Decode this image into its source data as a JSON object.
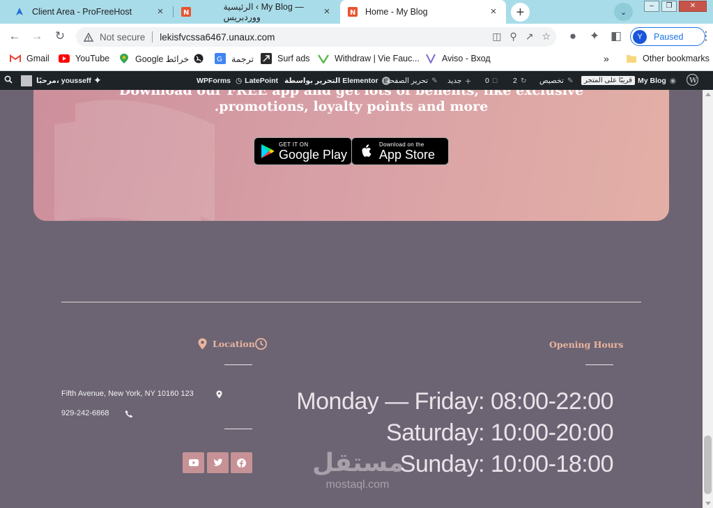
{
  "browser": {
    "tabs": [
      {
        "title": "Client Area - ProFreeHost",
        "icon": "profreehost-favicon",
        "active": false
      },
      {
        "title": "الرئيسية ‹ My Blog — ووردبريس",
        "icon": "blog-favicon",
        "active": false
      },
      {
        "title": "Home - My Blog",
        "icon": "blog-favicon",
        "active": true
      }
    ],
    "new_tab_icon": "plus-icon",
    "tab_search_icon": "chevron-down-icon",
    "address": {
      "security_label": "Not secure",
      "url": "lekisfvcssa6467.unaux.com"
    },
    "profile": {
      "initial": "Y",
      "label": "Paused"
    },
    "bookmarks": [
      {
        "label": "Gmail",
        "icon": "gmail-icon"
      },
      {
        "label": "YouTube",
        "icon": "youtube-icon"
      },
      {
        "label": "Google خرائط",
        "icon": "maps-icon"
      },
      {
        "label": "",
        "icon": "globe-icon"
      },
      {
        "label": "ترجمة",
        "icon": "translate-icon"
      },
      {
        "label": "Surf ads",
        "icon": "surf-icon"
      },
      {
        "label": "Withdraw | Vie Fauc...",
        "icon": "vie-icon"
      },
      {
        "label": "Aviso - Вход",
        "icon": "aviso-icon"
      }
    ],
    "overflow_label": "»",
    "other_bookmarks": "Other bookmarks"
  },
  "adminbar": {
    "site_name": "My Blog",
    "store_label": "قريبًا على المتجر",
    "customize": "تخصيص",
    "updates_count": "2",
    "comments_count": "0",
    "new": "جديد",
    "edit_page": "تحرير الصفحة",
    "edit_elementor": "التحرير بواسطة Elementor",
    "latepoint": "LatePoint",
    "wpforms": "WPForms",
    "greeting": "مرحبًا، yousseff"
  },
  "promo": {
    "line1": "Download our FREE app and get lots of benefits, like exclusive",
    "line2": ".promotions, loyalty points and more",
    "google_play": {
      "small": "GET IT ON",
      "big": "Google Play"
    },
    "app_store": {
      "small": "Download on the",
      "big": "App Store"
    }
  },
  "footer": {
    "location_heading": "Location",
    "hours_heading": "Opening Hours",
    "address": "Fifth Avenue, New York, NY 10160 123",
    "phone": "929-242-6868",
    "hours": [
      "Monday — Friday: 08:00-22:00",
      "Saturday: 10:00-20:00",
      "Sunday: 10:00-18:00"
    ],
    "social": [
      "youtube-icon",
      "twitter-icon",
      "facebook-icon"
    ]
  },
  "watermark": {
    "top": "مستقل",
    "bottom": "mostaql.com"
  },
  "colors": {
    "page_bg": "#6c6473",
    "accent": "#eab49d",
    "social_bg": "#c69296",
    "tabstrip": "#a9dce9"
  }
}
